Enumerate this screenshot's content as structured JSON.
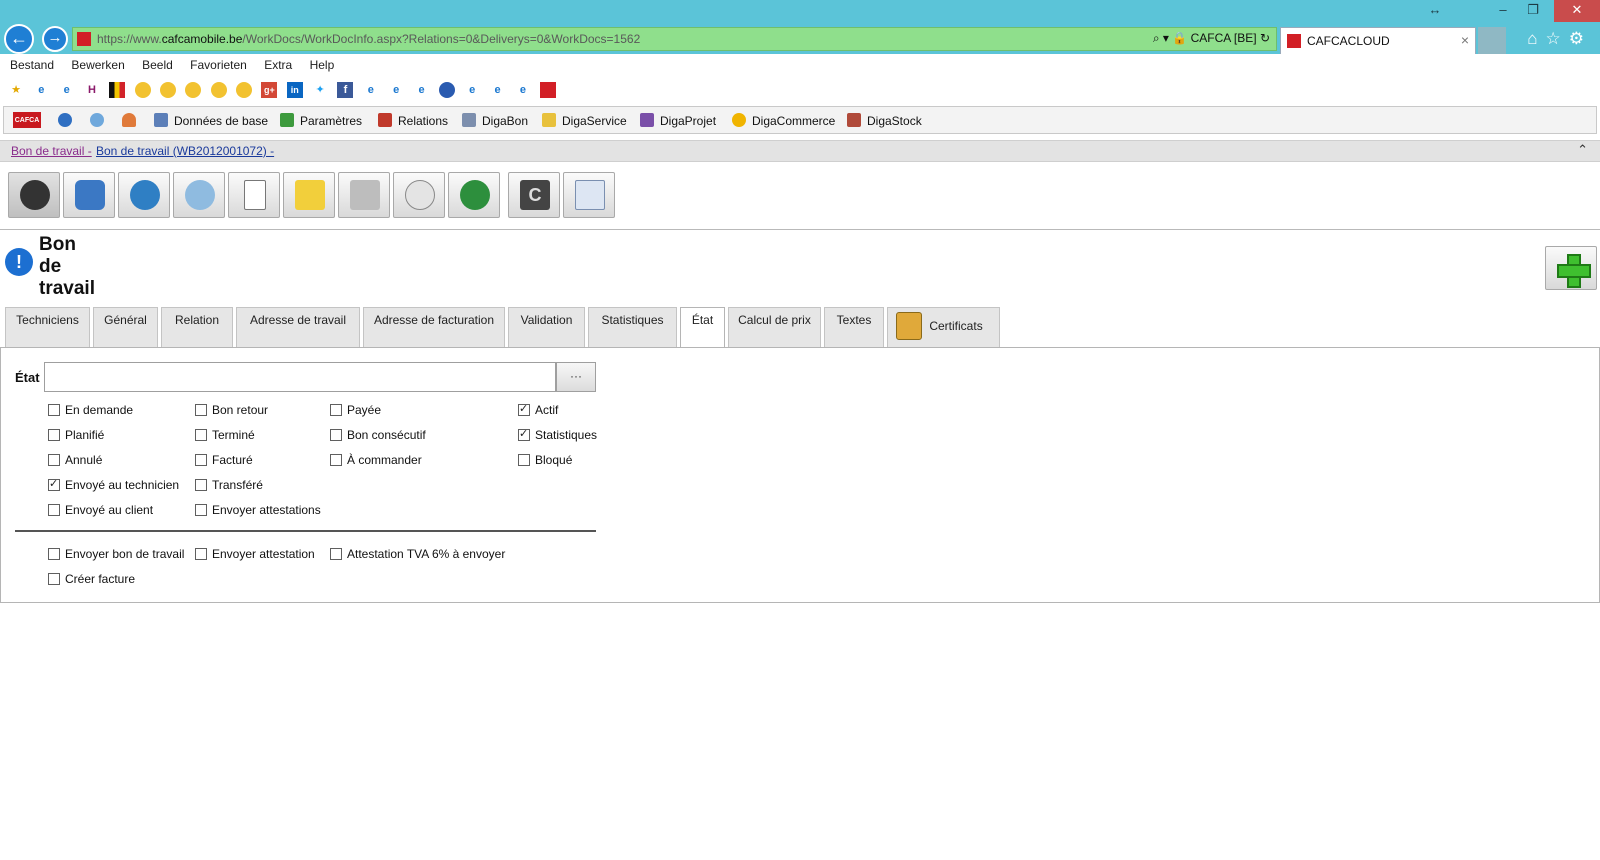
{
  "browser": {
    "url_prefix": "https://www.",
    "url_domain": "cafcamobile.be",
    "url_path": "/WorkDocs/WorkDocInfo.aspx?Relations=0&Deliverys=0&WorkDocs=1562",
    "site_identity": "CAFCA [BE]",
    "tab_title": "CAFCACLOUD",
    "menu": [
      "Bestand",
      "Bewerken",
      "Beeld",
      "Favorieten",
      "Extra",
      "Help"
    ]
  },
  "app_menu": {
    "logo": "CAFCA",
    "items": [
      "Données de base",
      "Paramètres",
      "Relations",
      "DigaBon",
      "DigaService",
      "DigaProjet",
      "DigaCommerce",
      "DigaStock"
    ]
  },
  "breadcrumb": {
    "first": "Bon de travail -",
    "second": "Bon de travail (WB2012001072) -"
  },
  "page": {
    "title_line1": "Bon",
    "title_line2": "de",
    "title_line3": "travail"
  },
  "tabs": [
    "Techniciens",
    "Général",
    "Relation",
    "Adresse de travail",
    "Adresse de facturation",
    "Validation",
    "Statistiques",
    "État",
    "Calcul de prix",
    "Textes",
    "Certificats"
  ],
  "active_tab": "État",
  "form": {
    "etat_label": "État",
    "etat_value": "",
    "etat_button": "···",
    "checkboxes": [
      {
        "label": "En demande",
        "checked": false
      },
      {
        "label": "Bon retour",
        "checked": false
      },
      {
        "label": "Payée",
        "checked": false
      },
      {
        "label": "Actif",
        "checked": true
      },
      {
        "label": "Planifié",
        "checked": false
      },
      {
        "label": "Terminé",
        "checked": false
      },
      {
        "label": "Bon consécutif",
        "checked": false
      },
      {
        "label": "Statistiques",
        "checked": true
      },
      {
        "label": "Annulé",
        "checked": false
      },
      {
        "label": "Facturé",
        "checked": false
      },
      {
        "label": "À commander",
        "checked": false
      },
      {
        "label": "Bloqué",
        "checked": false
      },
      {
        "label": "Envoyé au technicien",
        "checked": true
      },
      {
        "label": "Transféré",
        "checked": false
      },
      {
        "label": "Envoyé au client",
        "checked": false
      },
      {
        "label": "Envoyer attestations",
        "checked": false
      }
    ],
    "actions": [
      {
        "label": "Envoyer bon de travail",
        "checked": false
      },
      {
        "label": "Envoyer attestation",
        "checked": false
      },
      {
        "label": "Attestation TVA 6% à envoyer",
        "checked": false
      },
      {
        "label": "Créer facture",
        "checked": false
      }
    ]
  }
}
